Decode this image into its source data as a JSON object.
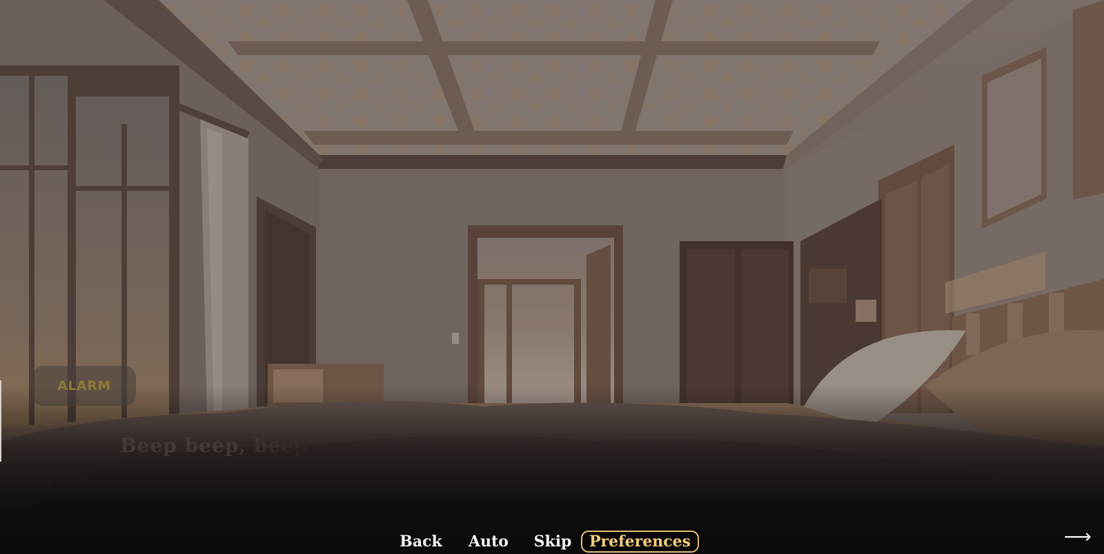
{
  "speaker": {
    "name": "ALARM"
  },
  "dialogue": {
    "text": "Beep beep, beep"
  },
  "quick_menu": {
    "back_label": "Back",
    "auto_label": "Auto",
    "skip_label": "Skip",
    "preferences_label": "Preferences",
    "active_item": "Preferences"
  },
  "advance_button": {
    "icon": "right-arrow-icon",
    "glyph": "⟶"
  },
  "colors": {
    "menu_text": "#f4f1ec",
    "active_text": "#f2cc7b",
    "active_border": "#e6c172",
    "speaker_name": "#8a7a38"
  },
  "scene": {
    "background": "bedroom-morning"
  }
}
